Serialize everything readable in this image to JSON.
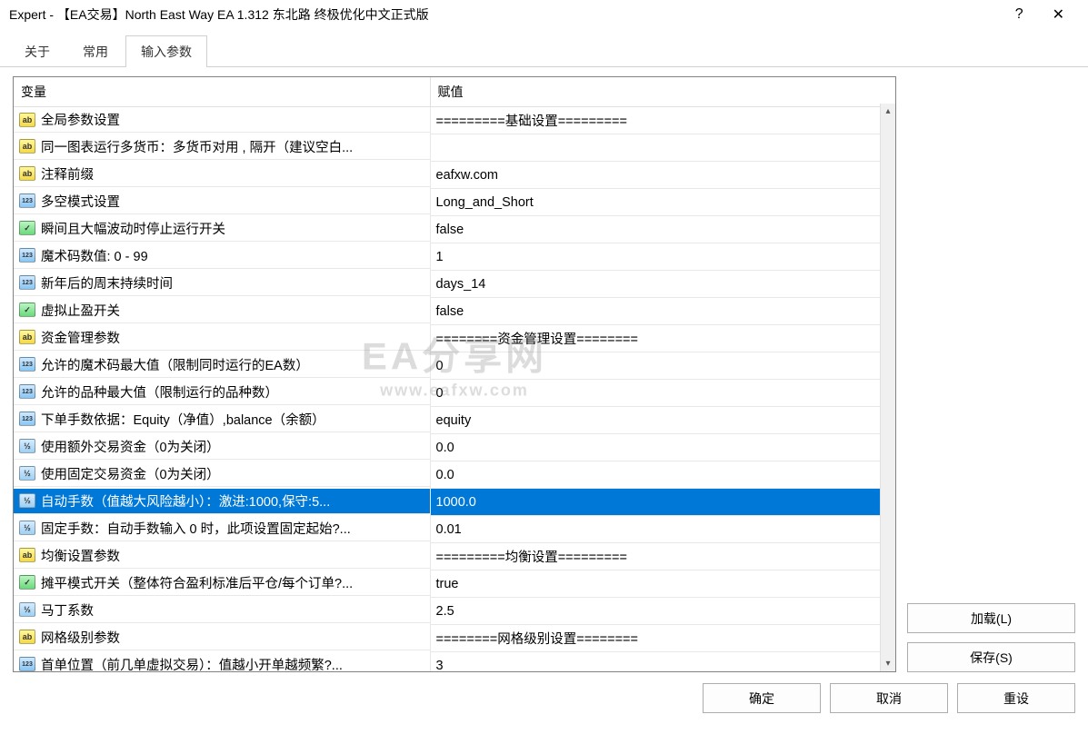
{
  "titlebar": {
    "title": "Expert -  【EA交易】North East Way EA 1.312 东北路 终极优化中文正式版",
    "help": "?",
    "close": "✕"
  },
  "tabs": {
    "items": [
      "关于",
      "常用",
      "输入参数"
    ],
    "active_index": 2
  },
  "table": {
    "headers": {
      "variable": "变量",
      "value": "赋值"
    },
    "selected_index": 14,
    "rows": [
      {
        "icon": "ab",
        "var": "全局参数设置",
        "val": "=========基础设置========="
      },
      {
        "icon": "ab",
        "var": "同一图表运行多货币：多货币对用 , 隔开（建议空白...",
        "val": ""
      },
      {
        "icon": "ab",
        "var": "注释前缀",
        "val": "eafxw.com"
      },
      {
        "icon": "123",
        "var": "多空模式设置",
        "val": "Long_and_Short"
      },
      {
        "icon": "bool",
        "var": "瞬间且大幅波动时停止运行开关",
        "val": "false"
      },
      {
        "icon": "123",
        "var": "魔术码数值: 0 - 99",
        "val": "1"
      },
      {
        "icon": "123",
        "var": "新年后的周末持续时间",
        "val": "days_14"
      },
      {
        "icon": "bool",
        "var": "虚拟止盈开关",
        "val": "false"
      },
      {
        "icon": "ab",
        "var": "资金管理参数",
        "val": "========资金管理设置========"
      },
      {
        "icon": "123",
        "var": "允许的魔术码最大值（限制同时运行的EA数）",
        "val": "0"
      },
      {
        "icon": "123",
        "var": "允许的品种最大值（限制运行的品种数）",
        "val": "0"
      },
      {
        "icon": "123",
        "var": "下单手数依据：Equity（净值）,balance（余额）",
        "val": "equity"
      },
      {
        "icon": "v2",
        "var": "使用额外交易资金（0为关闭）",
        "val": "0.0"
      },
      {
        "icon": "v2",
        "var": "使用固定交易资金（0为关闭）",
        "val": "0.0"
      },
      {
        "icon": "v2",
        "var": "自动手数（值越大风险越小）：激进:1000,保守:5...",
        "val": "1000.0"
      },
      {
        "icon": "v2",
        "var": "固定手数：自动手数输入 0 时，此项设置固定起始?...",
        "val": "0.01"
      },
      {
        "icon": "ab",
        "var": "均衡设置参数",
        "val": "=========均衡设置========="
      },
      {
        "icon": "bool",
        "var": "摊平模式开关（整体符合盈利标准后平仓/每个订单?...",
        "val": "true"
      },
      {
        "icon": "v2",
        "var": "马丁系数",
        "val": "2.5"
      },
      {
        "icon": "ab",
        "var": "网格级别参数",
        "val": "========网格级别设置========"
      },
      {
        "icon": "123",
        "var": "首单位置（前几单虚拟交易）：值越小开单越频繁?...",
        "val": "3"
      }
    ]
  },
  "side_buttons": {
    "load": "加载(L)",
    "save": "保存(S)"
  },
  "bottom_buttons": {
    "ok": "确定",
    "cancel": "取消",
    "reset": "重设"
  },
  "watermark": {
    "line1": "EA分享网",
    "line2": "www.eafxw.com"
  },
  "icons": {
    "ab": "ab",
    "123": "123",
    "bool": "✓",
    "v2": "½"
  },
  "scrollbar": {
    "up": "▴",
    "down": "▾"
  }
}
